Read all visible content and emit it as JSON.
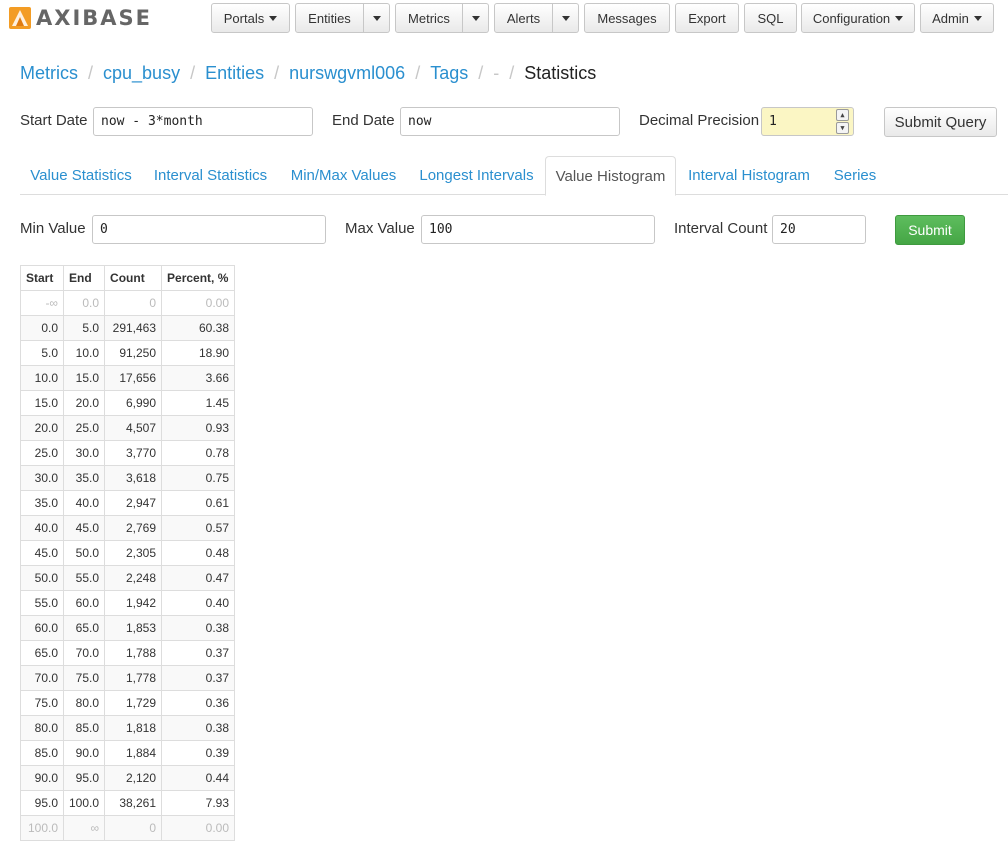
{
  "brand": {
    "logo_text": "AXIBASE",
    "logo_color": "#f39c24"
  },
  "nav": {
    "portals": "Portals",
    "entities": "Entities",
    "metrics": "Metrics",
    "alerts": "Alerts",
    "messages": "Messages",
    "export": "Export",
    "sql": "SQL",
    "configuration": "Configuration",
    "admin": "Admin"
  },
  "breadcrumb": {
    "metrics": "Metrics",
    "metric": "cpu_busy",
    "entities": "Entities",
    "entity": "nurswgvml006",
    "tags": "Tags",
    "tag_value": "-",
    "current": "Statistics",
    "separator": "/"
  },
  "query": {
    "start_label": "Start Date",
    "start_value": "now - 3*month",
    "end_label": "End Date",
    "end_value": "now",
    "precision_label": "Decimal Precision",
    "precision_value": "1",
    "submit_label": "Submit Query"
  },
  "tabs": [
    {
      "label": "Value Statistics"
    },
    {
      "label": "Interval Statistics"
    },
    {
      "label": "Min/Max Values"
    },
    {
      "label": "Longest Intervals"
    },
    {
      "label": "Value Histogram"
    },
    {
      "label": "Interval Histogram"
    },
    {
      "label": "Series"
    }
  ],
  "active_tab": "Value Histogram",
  "histogram_form": {
    "min_label": "Min Value",
    "min_value": "0",
    "max_label": "Max Value",
    "max_value": "100",
    "count_label": "Interval Count",
    "count_value": "20",
    "submit_label": "Submit"
  },
  "table": {
    "headers": [
      "Start",
      "End",
      "Count",
      "Percent, %"
    ],
    "rows": [
      [
        "-∞",
        "0.0",
        "0",
        "0.00"
      ],
      [
        "0.0",
        "5.0",
        "291,463",
        "60.38"
      ],
      [
        "5.0",
        "10.0",
        "91,250",
        "18.90"
      ],
      [
        "10.0",
        "15.0",
        "17,656",
        "3.66"
      ],
      [
        "15.0",
        "20.0",
        "6,990",
        "1.45"
      ],
      [
        "20.0",
        "25.0",
        "4,507",
        "0.93"
      ],
      [
        "25.0",
        "30.0",
        "3,770",
        "0.78"
      ],
      [
        "30.0",
        "35.0",
        "3,618",
        "0.75"
      ],
      [
        "35.0",
        "40.0",
        "2,947",
        "0.61"
      ],
      [
        "40.0",
        "45.0",
        "2,769",
        "0.57"
      ],
      [
        "45.0",
        "50.0",
        "2,305",
        "0.48"
      ],
      [
        "50.0",
        "55.0",
        "2,248",
        "0.47"
      ],
      [
        "55.0",
        "60.0",
        "1,942",
        "0.40"
      ],
      [
        "60.0",
        "65.0",
        "1,853",
        "0.38"
      ],
      [
        "65.0",
        "70.0",
        "1,788",
        "0.37"
      ],
      [
        "70.0",
        "75.0",
        "1,778",
        "0.37"
      ],
      [
        "75.0",
        "80.0",
        "1,729",
        "0.36"
      ],
      [
        "80.0",
        "85.0",
        "1,818",
        "0.38"
      ],
      [
        "85.0",
        "90.0",
        "1,884",
        "0.39"
      ],
      [
        "90.0",
        "95.0",
        "2,120",
        "0.44"
      ],
      [
        "95.0",
        "100.0",
        "38,261",
        "7.93"
      ],
      [
        "100.0",
        "∞",
        "0",
        "0.00"
      ]
    ],
    "muted_rows": [
      0,
      21
    ]
  }
}
